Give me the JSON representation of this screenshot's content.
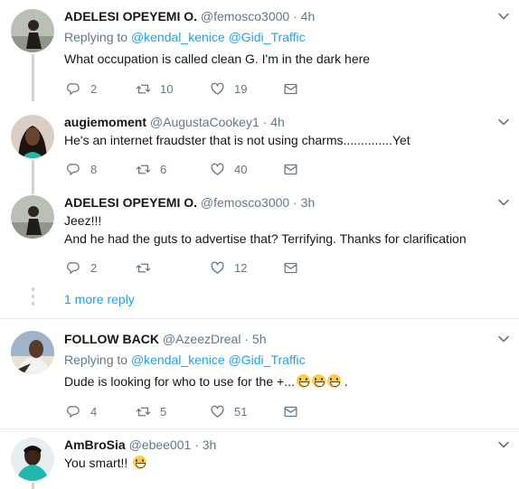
{
  "tweets": [
    {
      "name": "ADELESI OPEYEMI O.",
      "handle": "@femosco3000",
      "sep": "·",
      "time": "4h",
      "reply_prefix": "Replying to",
      "reply_mentions": [
        "@kendal_kenice",
        "@Gidi_Traffic"
      ],
      "text": "What occupation is called clean G. I'm in the dark here",
      "replies": "2",
      "retweets": "10",
      "likes": "19"
    },
    {
      "name": "augiemoment",
      "handle": "@AugustaCookey1",
      "sep": "·",
      "time": "4h",
      "text": "He's an internet fraudster that is not using charms..............Yet",
      "replies": "8",
      "retweets": "6",
      "likes": "40"
    },
    {
      "name": "ADELESI OPEYEMI O.",
      "handle": "@femosco3000",
      "sep": "·",
      "time": "3h",
      "text_line1": "Jeez!!!",
      "text_line2": "And he had the guts to advertise that? Terrifying. Thanks for clarification",
      "replies": "2",
      "retweets": "",
      "likes": "12"
    },
    {
      "name": "FOLLOW BACK",
      "handle": "@AzeezDreal",
      "sep": "·",
      "time": "5h",
      "reply_prefix": "Replying to",
      "reply_mentions": [
        "@kendal_kenice",
        "@Gidi_Traffic"
      ],
      "text": "Dude is looking for who to use for the +...",
      "text_suffix": ".",
      "replies": "4",
      "retweets": "5",
      "likes": "51"
    },
    {
      "name": "AmBroSia",
      "handle": "@ebee001",
      "sep": "·",
      "time": "3h",
      "text": "You smart!!"
    }
  ],
  "thread": {
    "more_replies": "1 more reply"
  },
  "colors": {
    "link": "#1da1f2",
    "muted": "#657786",
    "thread_line": "#ccd6dd"
  },
  "icons": {
    "reply": "reply-icon",
    "retweet": "retweet-icon",
    "like": "heart-icon",
    "dm": "envelope-icon",
    "caret": "chevron-down-icon"
  }
}
